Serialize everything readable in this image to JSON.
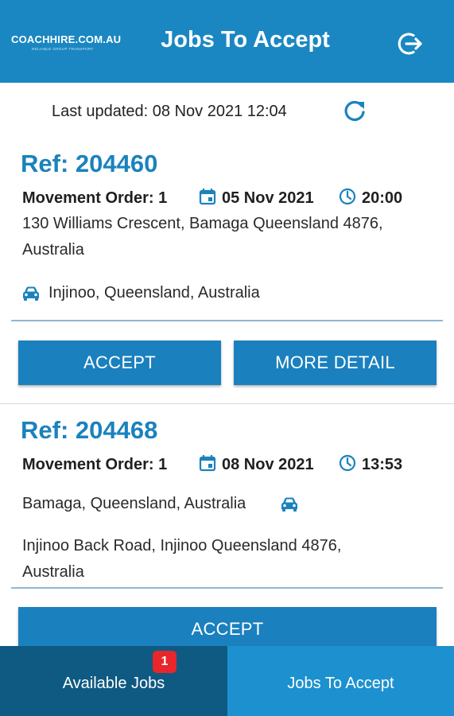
{
  "header": {
    "logo_text": "COACHHIRE.COM.AU",
    "logo_tagline": "RELIABLE GROUP TRANSPORT",
    "title": "Jobs To Accept",
    "logout_icon": "logout-icon"
  },
  "status": {
    "last_updated": "Last updated: 08 Nov 2021 12:04",
    "refresh_icon": "refresh-icon"
  },
  "jobs": [
    {
      "ref": "Ref: 204460",
      "movement_order": "Movement Order: 1",
      "date": "05 Nov 2021",
      "time": "20:00",
      "pickup_line1": "130 Williams Crescent, Bamaga Queensland 4876,",
      "pickup_line2": "Australia",
      "destination": "Injinoo, Queensland, Australia",
      "accept_label": "ACCEPT",
      "more_label": "MORE DETAIL"
    },
    {
      "ref": "Ref: 204468",
      "movement_order": "Movement Order: 1",
      "date": "08 Nov 2021",
      "time": "13:53",
      "pickup": "Bamaga, Queensland, Australia",
      "destination_line1": "Injinoo Back Road, Injinoo Queensland 4876,",
      "destination_line2": "Australia",
      "accept_label": "ACCEPT"
    }
  ],
  "tabs": [
    {
      "label": "Available Jobs",
      "badge": "1",
      "active": false
    },
    {
      "label": "Jobs To Accept",
      "active": true
    }
  ],
  "colors": {
    "header_bg": "#1a87c2",
    "accent_text": "#1a82bd",
    "button_bg": "#1a80be",
    "tab_inactive_bg": "#0f5a82",
    "tab_active_bg": "#1d91cf",
    "badge_bg": "#e8262b"
  }
}
